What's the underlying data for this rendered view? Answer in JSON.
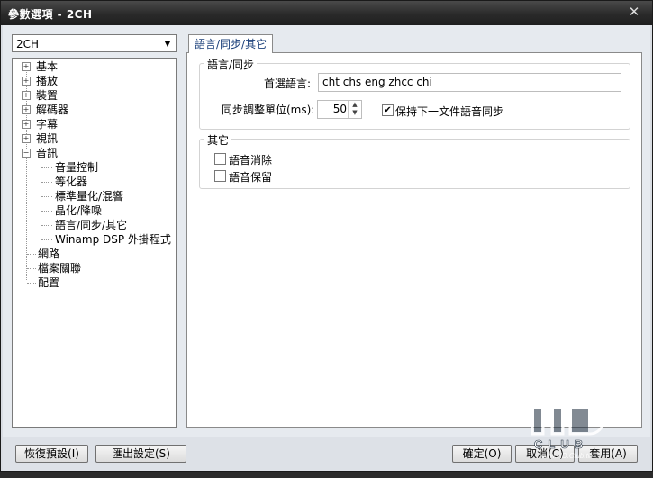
{
  "window": {
    "title": "參數選項 - 2CH",
    "close_glyph": "✕"
  },
  "profile_combo": {
    "value": "2CH"
  },
  "tree": {
    "items": [
      {
        "label": "基本",
        "expand": "+"
      },
      {
        "label": "播放",
        "expand": "+"
      },
      {
        "label": "裝置",
        "expand": "+"
      },
      {
        "label": "解碼器",
        "expand": "+"
      },
      {
        "label": "字幕",
        "expand": "+"
      },
      {
        "label": "視訊",
        "expand": "+"
      },
      {
        "label": "音訊",
        "expand": "−"
      },
      {
        "label": "音量控制"
      },
      {
        "label": "等化器"
      },
      {
        "label": "標準量化/混響"
      },
      {
        "label": "晶化/降噪"
      },
      {
        "label": "語言/同步/其它"
      },
      {
        "label": "Winamp DSP 外掛程式"
      },
      {
        "label": "網路"
      },
      {
        "label": "檔案關聯"
      },
      {
        "label": "配置"
      }
    ]
  },
  "tab": {
    "label": "語言/同步/其它"
  },
  "lang_sync": {
    "group_label": "語言/同步",
    "preferred_label": "首選語言:",
    "preferred_value": "cht chs eng zhcc chi",
    "sync_unit_label": "同步調整單位(ms):",
    "sync_unit_value": "50",
    "keep_sync_label": "保持下一文件語音同步",
    "keep_sync_checked": "✔"
  },
  "other": {
    "group_label": "其它",
    "mute_label": "語音消除",
    "keep_label": "語音保留"
  },
  "buttons": {
    "restore": "恢復預設(I)",
    "export": "匯出設定(S)",
    "ok": "確定(O)",
    "cancel": "取消(C)",
    "apply": "套用(A)"
  },
  "watermark": {
    "site": "www.HD.Club.tw"
  }
}
